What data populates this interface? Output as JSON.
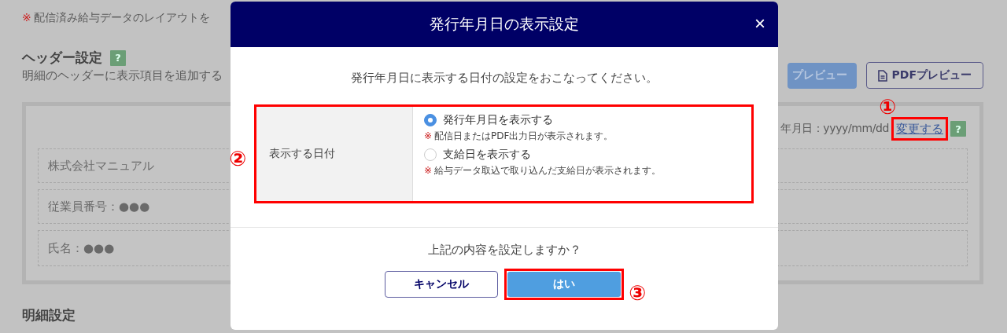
{
  "page": {
    "notice_mark": "※",
    "notice": "配信済み給与データのレイアウトを",
    "header_section": {
      "title": "ヘッダー設定",
      "help_mark": "?",
      "description": "明細のヘッダーに表示項目を追加する",
      "preview_button": "プレビュー",
      "pdf_preview_button": "PDFプレビュー",
      "issue_date_label": "年月日：yyyy/mm/dd",
      "change_link": "変更する",
      "help_mark_2": "?",
      "items": [
        "株式会社マニュアル",
        "従業員番号：●●●",
        "氏名：●●●"
      ]
    },
    "detail_section": {
      "title": "明細設定"
    }
  },
  "dialog": {
    "title": "発行年月日の表示設定",
    "close": "×",
    "instruction": "発行年月日に表示する日付の設定をおこなってください。",
    "field_label": "表示する日付",
    "options": [
      {
        "label": "発行年月日を表示する",
        "selected": true,
        "note_mark": "※",
        "note": "配信日またはPDF出力日が表示されます。"
      },
      {
        "label": "支給日を表示する",
        "selected": false,
        "note_mark": "※",
        "note": "給与データ取込で取り込んだ支給日が表示されます。"
      }
    ],
    "question": "上記の内容を設定しますか？",
    "buttons": [
      {
        "kind": "secondary",
        "label": "キャンセル"
      },
      {
        "kind": "primary",
        "label": "はい"
      }
    ]
  },
  "annotations": [
    "①",
    "②",
    "③"
  ]
}
